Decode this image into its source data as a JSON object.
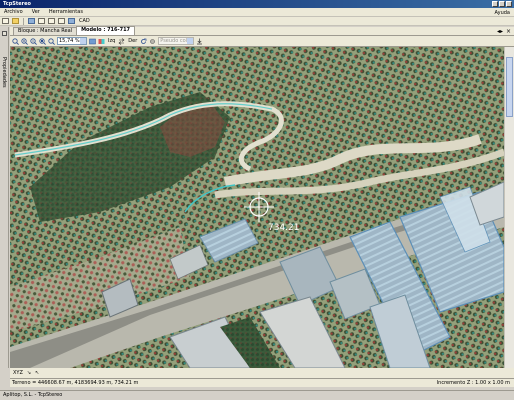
{
  "window": {
    "title": "TcpStereo"
  },
  "menu": {
    "items": [
      "Archivo",
      "Ver",
      "Herramientas"
    ],
    "help": "Ayuda"
  },
  "toolbar": {
    "cad_label": "CAD"
  },
  "side_panel": {
    "label": "Propiedades"
  },
  "tabs": [
    {
      "label": "Bloque : Mancha Real",
      "active": false
    },
    {
      "label": "Modelo : 716-717",
      "active": true
    }
  ],
  "viewbar": {
    "zoom": "15,74 %",
    "izq": "Izq",
    "der": "Der",
    "disabled_select": "Pseudo color"
  },
  "map": {
    "elevation_label": "734.21"
  },
  "map_tools": {
    "xyz": "XYZ"
  },
  "status": {
    "coords": "Terreno = 446608.67 m, 4183694.93 m, 734.21 m",
    "increment": "Incremento Z : 1.00 x 1.00 m"
  },
  "footer": {
    "text": "Aplitop, S.L. - TcpStereo"
  }
}
